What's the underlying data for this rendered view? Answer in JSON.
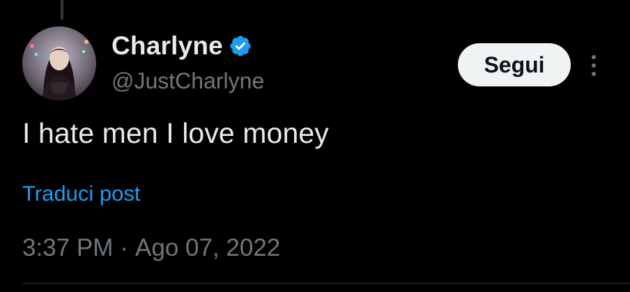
{
  "author": {
    "display_name": "Charlyne",
    "handle": "@JustCharlyne",
    "verified": true,
    "verified_color": "#1d9bf0"
  },
  "actions": {
    "follow_label": "Segui",
    "more_icon": "more-vertical-icon"
  },
  "tweet": {
    "text": "I hate men I love money",
    "translate_label": "Traduci post",
    "time": "3:37 PM",
    "separator": "·",
    "date": "Ago 07, 2022"
  },
  "colors": {
    "background": "#000000",
    "primary_text": "#e7e9ea",
    "secondary_text": "#71767b",
    "link": "#1d9bf0",
    "button_bg": "#eff3f4"
  }
}
